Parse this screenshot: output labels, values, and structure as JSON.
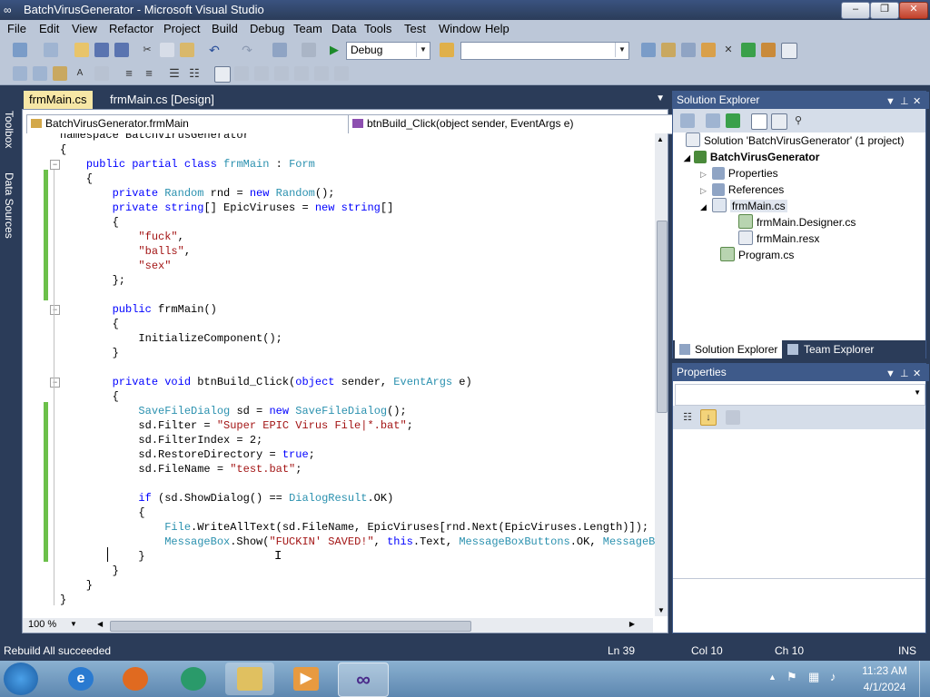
{
  "window": {
    "title": "BatchVirusGenerator - Microsoft Visual Studio",
    "minimize": "–",
    "maximize": "❐",
    "close": "✕"
  },
  "menu": [
    "File",
    "Edit",
    "View",
    "Refactor",
    "Project",
    "Build",
    "Debug",
    "Team",
    "Data",
    "Tools",
    "Test",
    "Window",
    "Help"
  ],
  "toolbar": {
    "config": "Debug",
    "platform": ""
  },
  "left_strip": {
    "toolbox": "Toolbox",
    "data_sources": "Data Sources"
  },
  "doc_tabs": [
    {
      "label": "frmMain.cs",
      "active": true
    },
    {
      "label": "frmMain.cs [Design]",
      "active": false
    }
  ],
  "editor": {
    "class_combo": "BatchVirusGenerator.frmMain",
    "member_combo": "btnBuild_Click(object sender, EventArgs e)",
    "zoom": "100 %",
    "lines": [
      [
        [
          "t",
          "namespace BatchVirusGenerator"
        ]
      ],
      [
        [
          "t",
          "{"
        ]
      ],
      [
        [
          "t",
          "    "
        ],
        [
          "kw",
          "public partial class "
        ],
        [
          "ty",
          "frmMain"
        ],
        [
          "t",
          " : "
        ],
        [
          "ty",
          "Form"
        ]
      ],
      [
        [
          "t",
          "    {"
        ]
      ],
      [
        [
          "t",
          "        "
        ],
        [
          "kw",
          "private "
        ],
        [
          "ty",
          "Random"
        ],
        [
          "t",
          " rnd = "
        ],
        [
          "kw",
          "new "
        ],
        [
          "ty",
          "Random"
        ],
        [
          "t",
          "();"
        ]
      ],
      [
        [
          "t",
          "        "
        ],
        [
          "kw",
          "private string"
        ],
        [
          "t",
          "[] EpicViruses = "
        ],
        [
          "kw",
          "new string"
        ],
        [
          "t",
          "[]"
        ]
      ],
      [
        [
          "t",
          "        {"
        ]
      ],
      [
        [
          "t",
          "            "
        ],
        [
          "st",
          "\"fuck\""
        ],
        [
          "t",
          ","
        ]
      ],
      [
        [
          "t",
          "            "
        ],
        [
          "st",
          "\"balls\""
        ],
        [
          "t",
          ","
        ]
      ],
      [
        [
          "t",
          "            "
        ],
        [
          "st",
          "\"sex\""
        ]
      ],
      [
        [
          "t",
          "        };"
        ]
      ],
      [
        [
          "t",
          ""
        ]
      ],
      [
        [
          "t",
          "        "
        ],
        [
          "kw",
          "public "
        ],
        [
          "t",
          "frmMain()"
        ]
      ],
      [
        [
          "t",
          "        {"
        ]
      ],
      [
        [
          "t",
          "            InitializeComponent();"
        ]
      ],
      [
        [
          "t",
          "        }"
        ]
      ],
      [
        [
          "t",
          ""
        ]
      ],
      [
        [
          "t",
          "        "
        ],
        [
          "kw",
          "private void "
        ],
        [
          "t",
          "btnBuild_Click("
        ],
        [
          "kw",
          "object "
        ],
        [
          "t",
          "sender, "
        ],
        [
          "ty",
          "EventArgs"
        ],
        [
          "t",
          " e)"
        ]
      ],
      [
        [
          "t",
          "        {"
        ]
      ],
      [
        [
          "t",
          "            "
        ],
        [
          "ty",
          "SaveFileDialog"
        ],
        [
          "t",
          " sd = "
        ],
        [
          "kw",
          "new "
        ],
        [
          "ty",
          "SaveFileDialog"
        ],
        [
          "t",
          "();"
        ]
      ],
      [
        [
          "t",
          "            sd.Filter = "
        ],
        [
          "st",
          "\"Super EPIC Virus File|*.bat\""
        ],
        [
          "t",
          ";"
        ]
      ],
      [
        [
          "t",
          "            sd.FilterIndex = 2;"
        ]
      ],
      [
        [
          "t",
          "            sd.RestoreDirectory = "
        ],
        [
          "kw",
          "true"
        ],
        [
          "t",
          ";"
        ]
      ],
      [
        [
          "t",
          "            sd.FileName = "
        ],
        [
          "st",
          "\"test.bat\""
        ],
        [
          "t",
          ";"
        ]
      ],
      [
        [
          "t",
          ""
        ]
      ],
      [
        [
          "t",
          "            "
        ],
        [
          "kw",
          "if "
        ],
        [
          "t",
          "(sd.ShowDialog() == "
        ],
        [
          "ty",
          "DialogResult"
        ],
        [
          "t",
          ".OK)"
        ]
      ],
      [
        [
          "t",
          "            {"
        ]
      ],
      [
        [
          "t",
          "                "
        ],
        [
          "ty",
          "File"
        ],
        [
          "t",
          ".WriteAllText(sd.FileName, EpicViruses[rnd.Next(EpicViruses.Length)]);"
        ]
      ],
      [
        [
          "t",
          "                "
        ],
        [
          "ty",
          "MessageBox"
        ],
        [
          "t",
          ".Show("
        ],
        [
          "st",
          "\"FUCKIN' SAVED!\""
        ],
        [
          "t",
          ", "
        ],
        [
          "kw",
          "this"
        ],
        [
          "t",
          ".Text, "
        ],
        [
          "ty",
          "MessageBoxButtons"
        ],
        [
          "t",
          ".OK, "
        ],
        [
          "ty",
          "MessageBoxI"
        ]
      ],
      [
        [
          "t",
          "            }"
        ]
      ],
      [
        [
          "t",
          "        }"
        ]
      ],
      [
        [
          "t",
          "    }"
        ]
      ],
      [
        [
          "t",
          "}"
        ]
      ]
    ]
  },
  "solution_explorer": {
    "title": "Solution Explorer",
    "items": [
      {
        "label": "Solution 'BatchVirusGenerator' (1 project)",
        "bold": false
      },
      {
        "label": "BatchVirusGenerator",
        "bold": true
      },
      {
        "label": "Properties",
        "bold": false
      },
      {
        "label": "References",
        "bold": false
      },
      {
        "label": "frmMain.cs",
        "bold": false
      },
      {
        "label": "frmMain.Designer.cs",
        "bold": false
      },
      {
        "label": "frmMain.resx",
        "bold": false
      },
      {
        "label": "Program.cs",
        "bold": false
      }
    ],
    "tabs": [
      "Solution Explorer",
      "Team Explorer"
    ]
  },
  "properties": {
    "title": "Properties"
  },
  "status": {
    "message": "Rebuild All succeeded",
    "ln": "Ln 39",
    "col": "Col 10",
    "ch": "Ch 10",
    "mode": "INS"
  },
  "taskbar": {
    "time": "11:23 AM",
    "date": "4/1/2024"
  },
  "colors": {
    "keyword": "#0000ff",
    "type": "#2b91af",
    "string": "#a31515",
    "chrome": "#2b3c59",
    "change_bar": "#6cc04a"
  }
}
